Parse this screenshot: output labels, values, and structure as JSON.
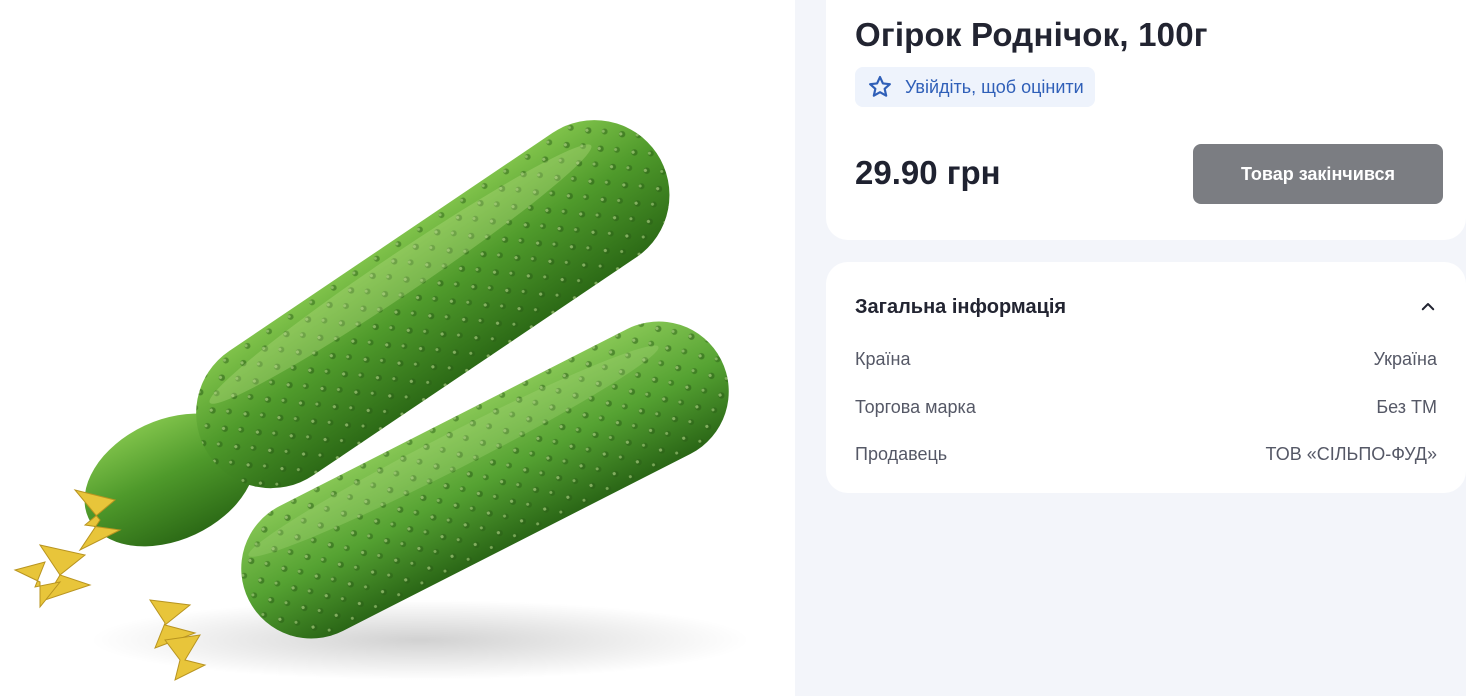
{
  "product": {
    "title": "Огірок Роднічок, 100г",
    "image_alt": "cucumbers",
    "rating_prompt": "Увійдіть, щоб оцінити",
    "price": "29.90 грн",
    "out_of_stock_label": "Товар закінчився"
  },
  "general_info": {
    "heading": "Загальна інформація",
    "rows": [
      {
        "label": "Країна",
        "value": "Україна"
      },
      {
        "label": "Торгова марка",
        "value": "Без ТМ"
      },
      {
        "label": "Продавець",
        "value": "ТОВ «СІЛЬПО-ФУД»"
      }
    ]
  },
  "colors": {
    "accent_blue": "#2f5fb8",
    "chip_bg": "#eef3fc",
    "button_disabled": "#7b7d82",
    "page_bg": "#f3f5fa"
  },
  "icons": {
    "rating": "star-outline-icon",
    "collapse": "chevron-up-icon"
  }
}
